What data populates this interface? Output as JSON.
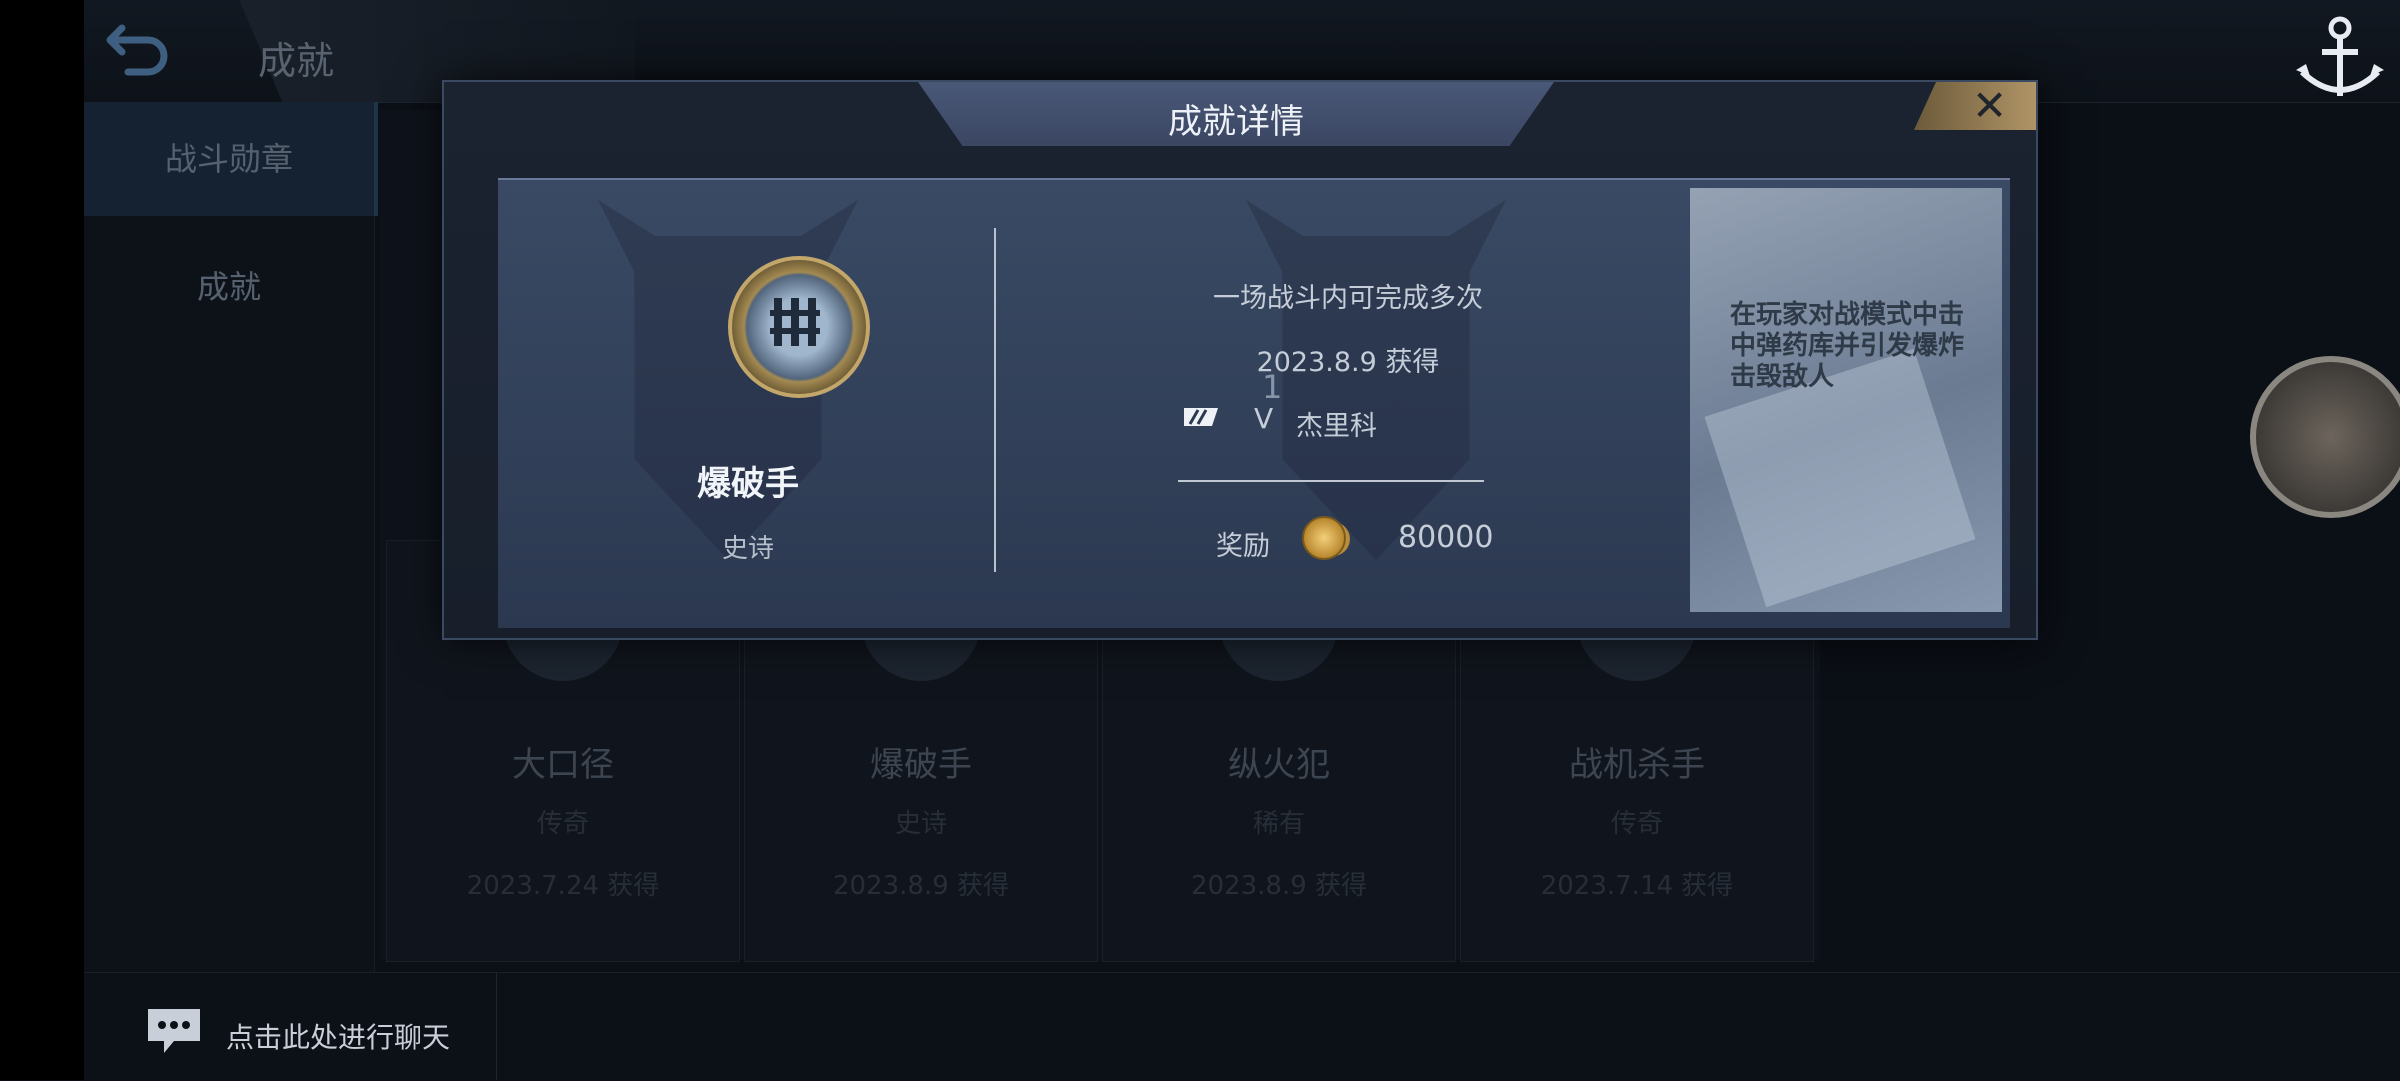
{
  "header": {
    "title": "成就"
  },
  "sidebar": {
    "items": [
      {
        "label": "战斗勋章"
      },
      {
        "label": "成就"
      }
    ]
  },
  "cards": [
    {
      "name": "大口径",
      "rarity": "传奇",
      "date": "2023.7.24  获得"
    },
    {
      "name": "爆破手",
      "rarity": "史诗",
      "date": "2023.8.9  获得"
    },
    {
      "name": "纵火犯",
      "rarity": "稀有",
      "date": "2023.8.9  获得"
    },
    {
      "name": "战机杀手",
      "rarity": "传奇",
      "date": "2023.7.14  获得"
    }
  ],
  "modal": {
    "title": "成就详情",
    "close_icon": "close-icon",
    "badge_name": "爆破手",
    "badge_rarity": "史诗",
    "count": "1",
    "info_line": "一场战斗内可完成多次",
    "date": "2023.8.9  获得",
    "rank_symbol": "V",
    "player": "杰里科",
    "reward_label": "奖励",
    "reward_value": "80000",
    "description": "在玩家对战模式中击中弹药库并引发爆炸击毁敌人"
  },
  "chat": {
    "prompt": "点击此处进行聊天"
  },
  "colors": {
    "accent_gold": "#b09466",
    "modal_bg": "#2b3850"
  }
}
